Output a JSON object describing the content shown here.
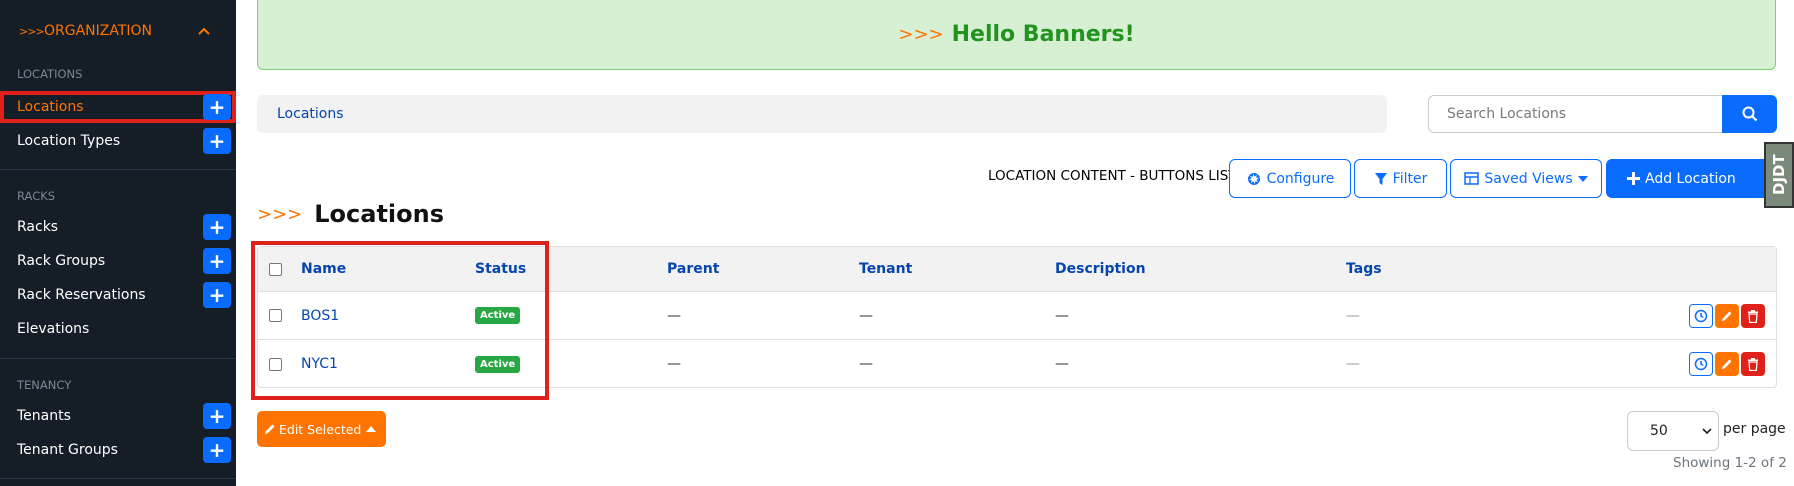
{
  "sidebar": {
    "header": {
      "chevrons": ">>>",
      "title": "ORGANIZATION",
      "caret": "^"
    },
    "groups": {
      "locations": "LOCATIONS",
      "racks": "RACKS",
      "tenancy": "TENANCY"
    },
    "items": {
      "locations": "Locations",
      "location_types": "Location Types",
      "racks": "Racks",
      "rack_groups": "Rack Groups",
      "rack_reservations": "Rack Reservations",
      "elevations": "Elevations",
      "tenants": "Tenants",
      "tenant_groups": "Tenant Groups"
    },
    "plus": "+"
  },
  "banner": {
    "arrows": ">>>",
    "text": "Hello Banners!"
  },
  "breadcrumb": {
    "label": "Locations"
  },
  "search": {
    "placeholder": "Search Locations"
  },
  "toolbar": {
    "label": "LOCATION CONTENT - BUTTONS LIST",
    "configure": "Configure",
    "filter": "Filter",
    "saved_views": "Saved Views",
    "add": "Add Location"
  },
  "djdt": "DJDT",
  "page": {
    "arrows": ">>>",
    "title": "Locations"
  },
  "table": {
    "headers": {
      "name": "Name",
      "status": "Status",
      "parent": "Parent",
      "tenant": "Tenant",
      "description": "Description",
      "tags": "Tags"
    },
    "rows": [
      {
        "name": "BOS1",
        "status": "Active",
        "parent": "—",
        "tenant": "—",
        "description": "—",
        "tags": "—"
      },
      {
        "name": "NYC1",
        "status": "Active",
        "parent": "—",
        "tenant": "—",
        "description": "—",
        "tags": "—"
      }
    ]
  },
  "footer": {
    "edit_selected": "Edit Selected",
    "per_page_value": "50",
    "per_page_label": "per page",
    "showing": "Showing 1-2 of 2"
  },
  "colors": {
    "accent_orange": "#ff7400",
    "primary_blue": "#0a6cff",
    "success_green": "#28a745",
    "danger_red": "#e0201a",
    "sidebar_bg": "#151d27"
  }
}
